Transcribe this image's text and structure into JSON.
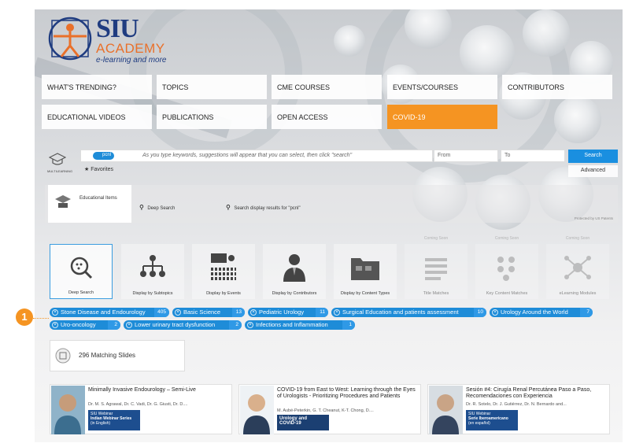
{
  "logo": {
    "line1": "SIU",
    "line2": "ACADEMY",
    "tagline": "e-learning and more"
  },
  "nav": [
    "WHAT'S TRENDING?",
    "TOPICS",
    "CME COURSES",
    "EVENTS/COURSES",
    "CONTRIBUTORS",
    "EDUCATIONAL VIDEOS",
    "PUBLICATIONS",
    "OPEN ACCESS",
    "COVID-19"
  ],
  "search": {
    "pill": "pcnl",
    "placeholder": "As you type keywords, suggestions will appear that you can select, then click \"search\"",
    "from": "From",
    "to": "To",
    "search_button": "Search",
    "advanced_button": "Advanced",
    "favorites": "Favorites",
    "multilearning": "MULTILEARNING"
  },
  "types": {
    "educational": "Educational Items",
    "deep": "Deep Search",
    "display": "Search display results for \"pcnl\"",
    "protected": "Protected by US Patents"
  },
  "tiles": [
    {
      "label": "Deep Search",
      "soon": ""
    },
    {
      "label": "Display by Subtopics",
      "soon": ""
    },
    {
      "label": "Display by Events",
      "soon": ""
    },
    {
      "label": "Display by Contributors",
      "soon": ""
    },
    {
      "label": "Display by Content Types",
      "soon": ""
    },
    {
      "label": "Title Matches",
      "soon": "Coming Soon"
    },
    {
      "label": "Key Content Matches",
      "soon": "Coming Soon"
    },
    {
      "label": "eLearning Modules",
      "soon": "Coming Soon"
    }
  ],
  "chips": [
    {
      "label": "Stone Disease and Endourology",
      "count": "405"
    },
    {
      "label": "Basic Science",
      "count": "13"
    },
    {
      "label": "Pediatric Urology",
      "count": "11"
    },
    {
      "label": "Surgical Education and patients assessment",
      "count": "10"
    },
    {
      "label": "Urology Around the World",
      "count": "7"
    },
    {
      "label": "Uro-oncology",
      "count": "2"
    },
    {
      "label": "Lower urinary tract dysfunction",
      "count": "2"
    },
    {
      "label": "Infections and Inflammation",
      "count": "1"
    }
  ],
  "callout": "1",
  "slides": "296 Matching Slides",
  "cards": [
    {
      "title": "Minimally Invasive Endourology – Semi-Live",
      "authors": "Dr. M. S. Agrawal, Dr. C. Vadi, Dr. G. Giusti, Dr. D....",
      "b1": "SIU Webinar",
      "b2": "Indian Webinar Series",
      "b3": "(in English)"
    },
    {
      "title": "COVID-19 from East to West: Learning through the Eyes of Urologists - Prioritizing Procedures and Patients",
      "authors": "M. Aubé-Peterkin, G. T. Cheanut, K-T. Chong, D....",
      "b1": "",
      "b2": "Urology and",
      "b3": "COVID-19"
    },
    {
      "title": "Sesión #4: Cirugía Renal Percutánea Paso a Paso, Recomendaciones con Experiencia",
      "authors": "Dr. R. Sotelo, Dr. J. Gutiérrez, Dr. N. Bernardo and...",
      "b1": "SIU Webinar",
      "b2": "Serie Iberoamericano",
      "b3": "(en español)"
    }
  ],
  "colors": {
    "accent": "#f59422",
    "brand_blue": "#1f3c80",
    "chip_blue": "#1e8cd8"
  }
}
